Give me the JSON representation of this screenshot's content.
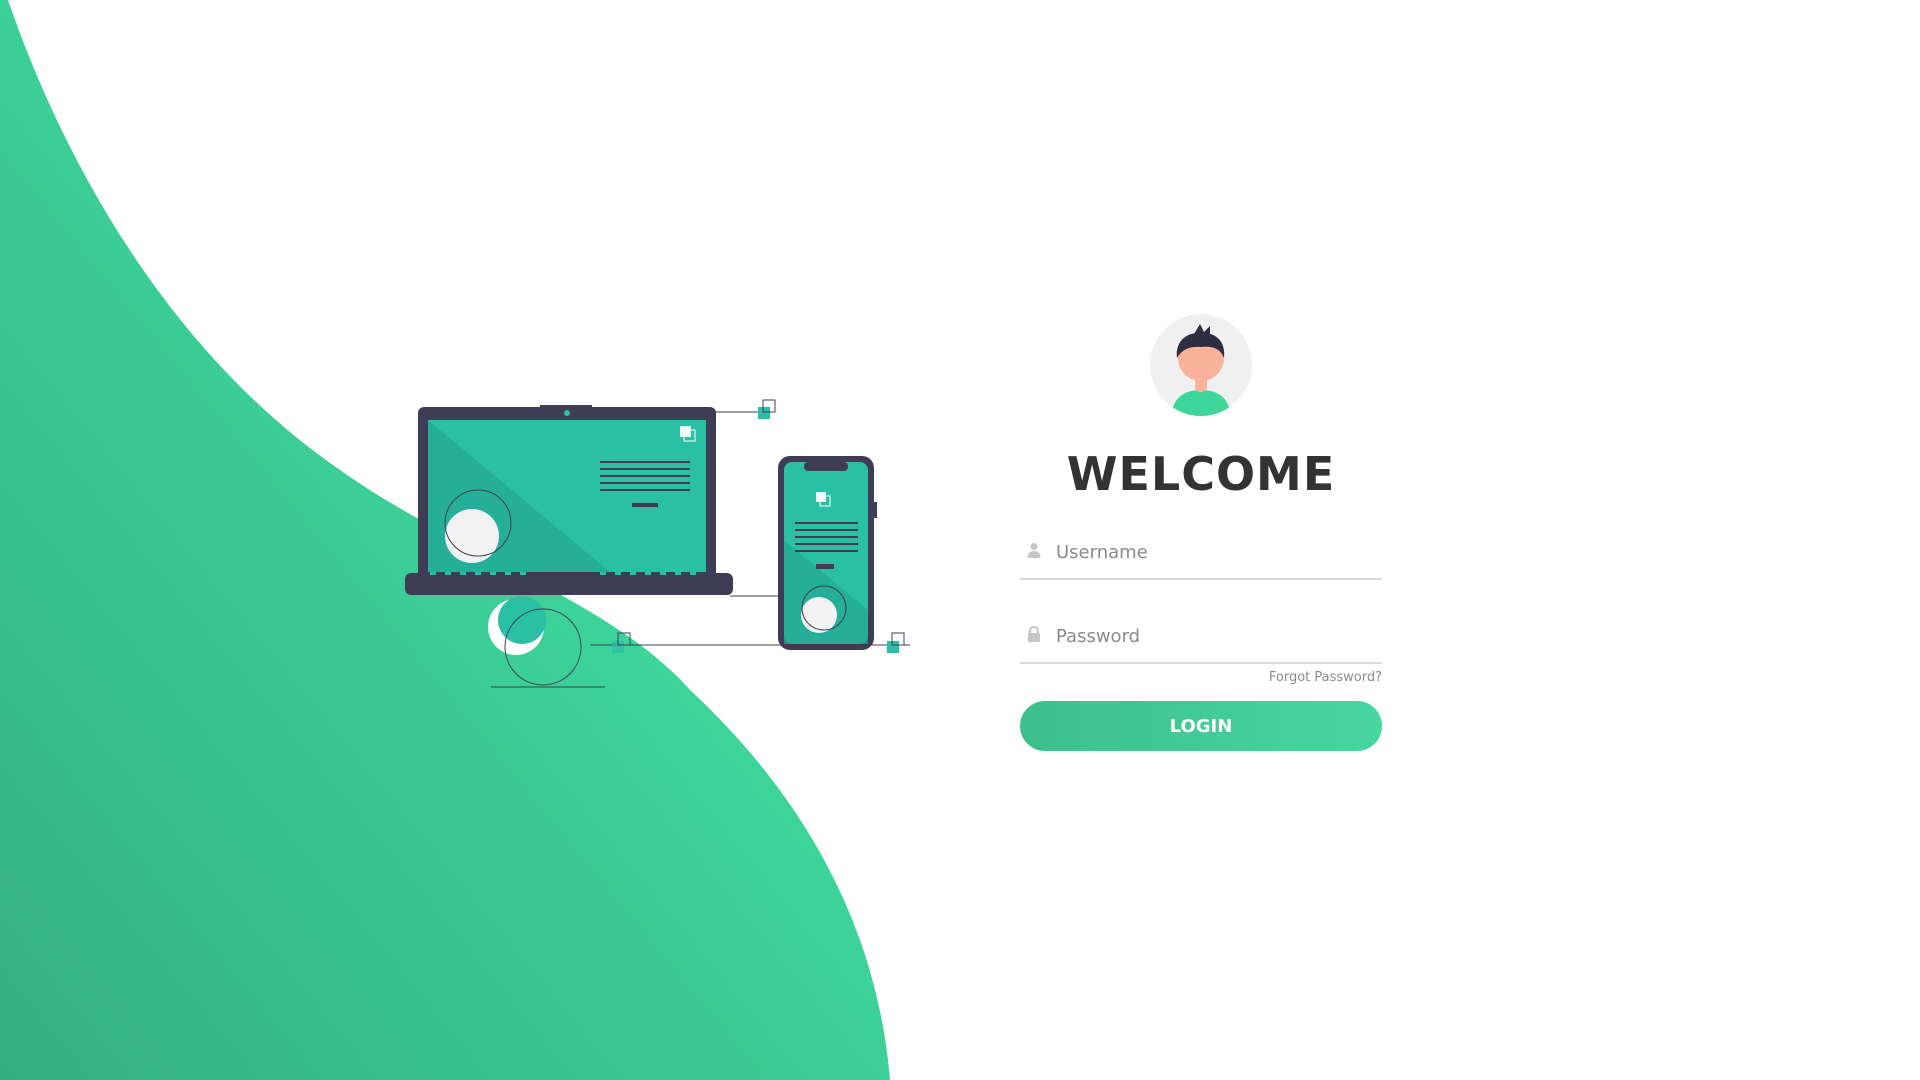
{
  "colors": {
    "accent": "#3ed69a",
    "accent_dark": "#33b07f",
    "teal": "#2bbfa5",
    "device_frame": "#3f3d56",
    "text_dark": "#333333",
    "text_muted": "#8a8a8a"
  },
  "login": {
    "title": "WELCOME",
    "username": {
      "placeholder": "Username",
      "value": "",
      "icon": "user-icon"
    },
    "password": {
      "placeholder": "Password",
      "value": "",
      "icon": "lock-icon"
    },
    "forgot_label": "Forgot Password?",
    "button_label": "LOGIN",
    "avatar_icon": "user-avatar-icon"
  }
}
